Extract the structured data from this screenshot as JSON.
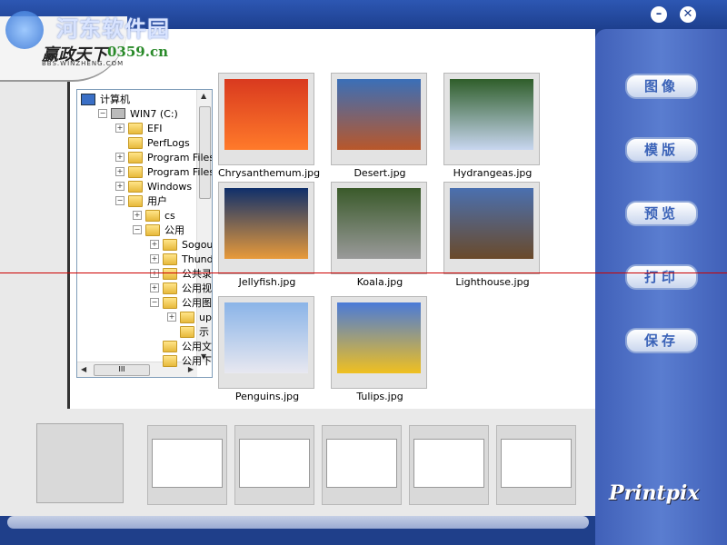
{
  "watermark": "河东软件园",
  "logo": {
    "text": "赢政天下",
    "sub": "BBS.WINZHENG.COM",
    "url": "0359.cn"
  },
  "window_controls": {
    "minimize": "–",
    "close": "✕"
  },
  "tree": {
    "root": "计算机",
    "items": [
      {
        "label": "计算机",
        "level": 0,
        "icon": "computer-icon",
        "expander": ""
      },
      {
        "label": "WIN7 (C:)",
        "level": 1,
        "icon": "drive-icon",
        "expander": "−"
      },
      {
        "label": "EFI",
        "level": 2,
        "icon": "folder-icon",
        "expander": "+"
      },
      {
        "label": "PerfLogs",
        "level": 2,
        "icon": "folder-icon",
        "expander": ""
      },
      {
        "label": "Program Files",
        "level": 2,
        "icon": "folder-icon",
        "expander": "+"
      },
      {
        "label": "Program Files (x",
        "level": 2,
        "icon": "folder-icon",
        "expander": "+"
      },
      {
        "label": "Windows",
        "level": 2,
        "icon": "folder-icon",
        "expander": "+"
      },
      {
        "label": "用户",
        "level": 2,
        "icon": "folder-icon",
        "expander": "−"
      },
      {
        "label": "cs",
        "level": 3,
        "icon": "folder-icon",
        "expander": "+"
      },
      {
        "label": "公用",
        "level": 3,
        "icon": "folder-icon",
        "expander": "−"
      },
      {
        "label": "Sogoul",
        "level": 4,
        "icon": "folder-icon",
        "expander": "+"
      },
      {
        "label": "Thunde",
        "level": 4,
        "icon": "folder-icon",
        "expander": "+"
      },
      {
        "label": "公共录",
        "level": 4,
        "icon": "folder-icon",
        "expander": "+"
      },
      {
        "label": "公用视",
        "level": 4,
        "icon": "folder-icon",
        "expander": "+"
      },
      {
        "label": "公用图",
        "level": 4,
        "icon": "folder-icon",
        "expander": "−"
      },
      {
        "label": "upl",
        "level": 5,
        "icon": "folder-icon",
        "expander": "+"
      },
      {
        "label": "示",
        "level": 5,
        "icon": "folder-icon",
        "expander": ""
      },
      {
        "label": "公用文",
        "level": 4,
        "icon": "folder-icon",
        "expander": ""
      },
      {
        "label": "公用下",
        "level": 4,
        "icon": "folder-icon",
        "expander": ""
      }
    ],
    "hscroll_label": "III"
  },
  "thumbnails": [
    {
      "label": "Chrysanthemum.jpg",
      "colors": [
        "#d93a1f",
        "#ff7a2a"
      ]
    },
    {
      "label": "Desert.jpg",
      "colors": [
        "#3a6fb8",
        "#b9572a"
      ]
    },
    {
      "label": "Hydrangeas.jpg",
      "colors": [
        "#2f5e2a",
        "#c8d6f0"
      ]
    },
    {
      "label": "Jellyfish.jpg",
      "colors": [
        "#0f2f6b",
        "#e89a3a"
      ]
    },
    {
      "label": "Koala.jpg",
      "colors": [
        "#3a5a2a",
        "#9a9a9a"
      ]
    },
    {
      "label": "Lighthouse.jpg",
      "colors": [
        "#4a70b0",
        "#6a4a2a"
      ]
    },
    {
      "label": "Penguins.jpg",
      "colors": [
        "#8ab4e8",
        "#e8e8f0"
      ]
    },
    {
      "label": "Tulips.jpg",
      "colors": [
        "#4a7ad8",
        "#f0c020"
      ]
    }
  ],
  "right_buttons": [
    "图像",
    "模版",
    "预览",
    "打印",
    "保存"
  ],
  "brand": "Printpix",
  "colors": {
    "frame_blue": "#1f3f8a",
    "panel_blue": "#4f6fc4",
    "button_text": "#3b63b8"
  }
}
